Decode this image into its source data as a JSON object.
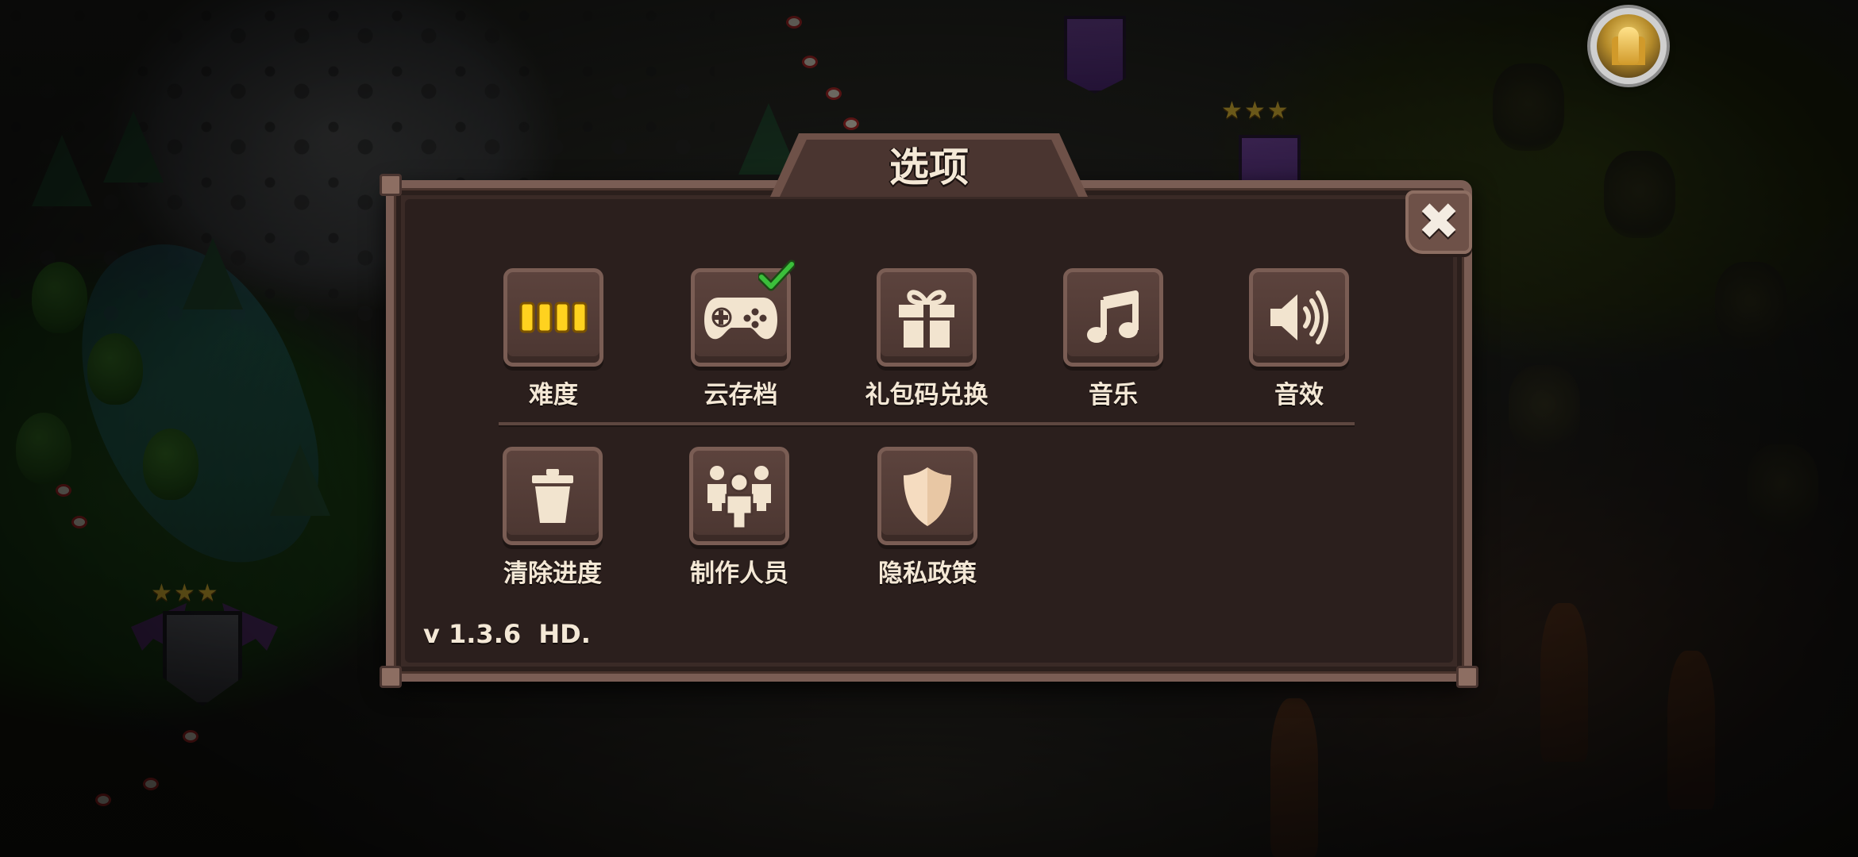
{
  "dialog": {
    "title": "选项",
    "close_icon": "close-icon",
    "version": "v 1.3.6  HD."
  },
  "options_row1": [
    {
      "id": "difficulty",
      "label": "难度",
      "icon": "difficulty-bars-icon"
    },
    {
      "id": "cloud-save",
      "label": "云存档",
      "icon": "gamepad-icon",
      "badge": "checkmark-icon",
      "checked": true
    },
    {
      "id": "gift-code",
      "label": "礼包码兑换",
      "icon": "gift-icon"
    },
    {
      "id": "music",
      "label": "音乐",
      "icon": "music-note-icon"
    },
    {
      "id": "sound-effects",
      "label": "音效",
      "icon": "speaker-icon"
    }
  ],
  "options_row2": [
    {
      "id": "clear-progress",
      "label": "清除进度",
      "icon": "trash-icon"
    },
    {
      "id": "credits",
      "label": "制作人员",
      "icon": "people-icon"
    },
    {
      "id": "privacy-policy",
      "label": "隐私政策",
      "icon": "shield-icon"
    }
  ],
  "difficulty_level": {
    "filled": 4,
    "total": 4
  },
  "hud": {
    "avatar": "hero-portrait"
  },
  "colors": {
    "panel_bg": "#2b1f1d",
    "panel_border": "#7a5d54",
    "tile_bg": "#5c433d",
    "text": "#f4e8d6",
    "icon_cream": "#f2e4cf",
    "difficulty_yellow": "#ffd21f",
    "check_green": "#3bbf3b",
    "star_gold": "#f3c93a"
  }
}
